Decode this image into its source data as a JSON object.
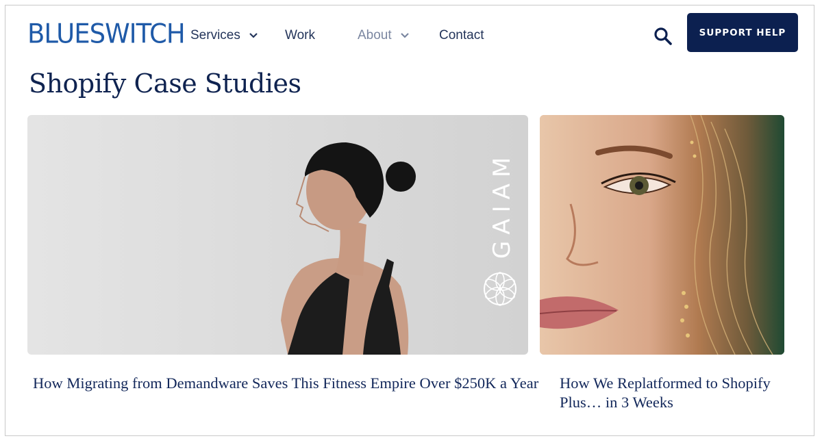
{
  "header": {
    "logo": "BLUESWITCH",
    "nav": [
      {
        "label": "Services",
        "has_dropdown": true
      },
      {
        "label": "Work",
        "has_dropdown": false
      },
      {
        "label": "About",
        "has_dropdown": true
      },
      {
        "label": "Contact",
        "has_dropdown": false
      }
    ],
    "search_icon": "search-icon",
    "support_button": "SUPPORT HELP"
  },
  "main": {
    "title": "Shopify Case Studies",
    "cards": [
      {
        "image": "woman-yoga-profile-photo",
        "brand": "GAIAM",
        "title": "How Migrating from Demandware Saves This Fitness Empire Over $250K a Year"
      },
      {
        "image": "woman-face-closeup-photo",
        "title": "How We Replatformed to Shopify Plus… in 3 Weeks"
      }
    ]
  },
  "colors": {
    "brand": "#1f5aa8",
    "navy": "#0c2050",
    "text": "#12275a"
  }
}
